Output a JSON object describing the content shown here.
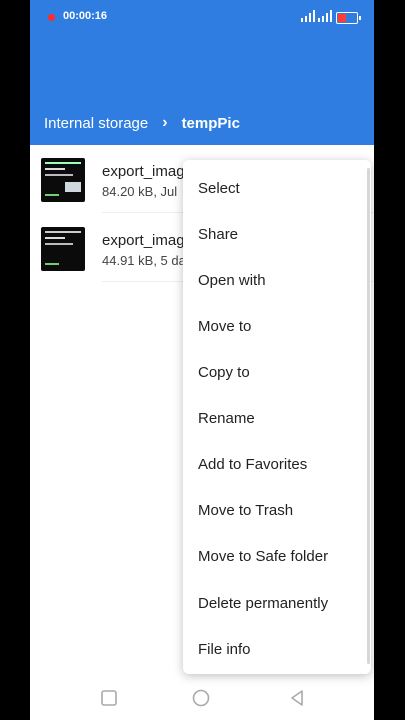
{
  "status_bar": {
    "recording_time": "00:00:16",
    "colors": {
      "record_dot": "#ff2b2b",
      "battery_low": "#ff3b3b"
    }
  },
  "header": {
    "breadcrumb": [
      "Internal storage",
      "tempPic"
    ],
    "background": "#2f7de1"
  },
  "files": [
    {
      "name": "export_imag",
      "meta": "84.20 kB, Jul"
    },
    {
      "name": "export_imag",
      "meta": "44.91 kB, 5 da"
    }
  ],
  "context_menu": {
    "items": [
      "Select",
      "Share",
      "Open with",
      "Move to",
      "Copy to",
      "Rename",
      "Add to Favorites",
      "Move to Trash",
      "Move to Safe folder",
      "Delete permanently",
      "File info"
    ]
  },
  "nav_bar": {
    "buttons": [
      "recents-icon",
      "home-icon",
      "back-icon"
    ]
  }
}
